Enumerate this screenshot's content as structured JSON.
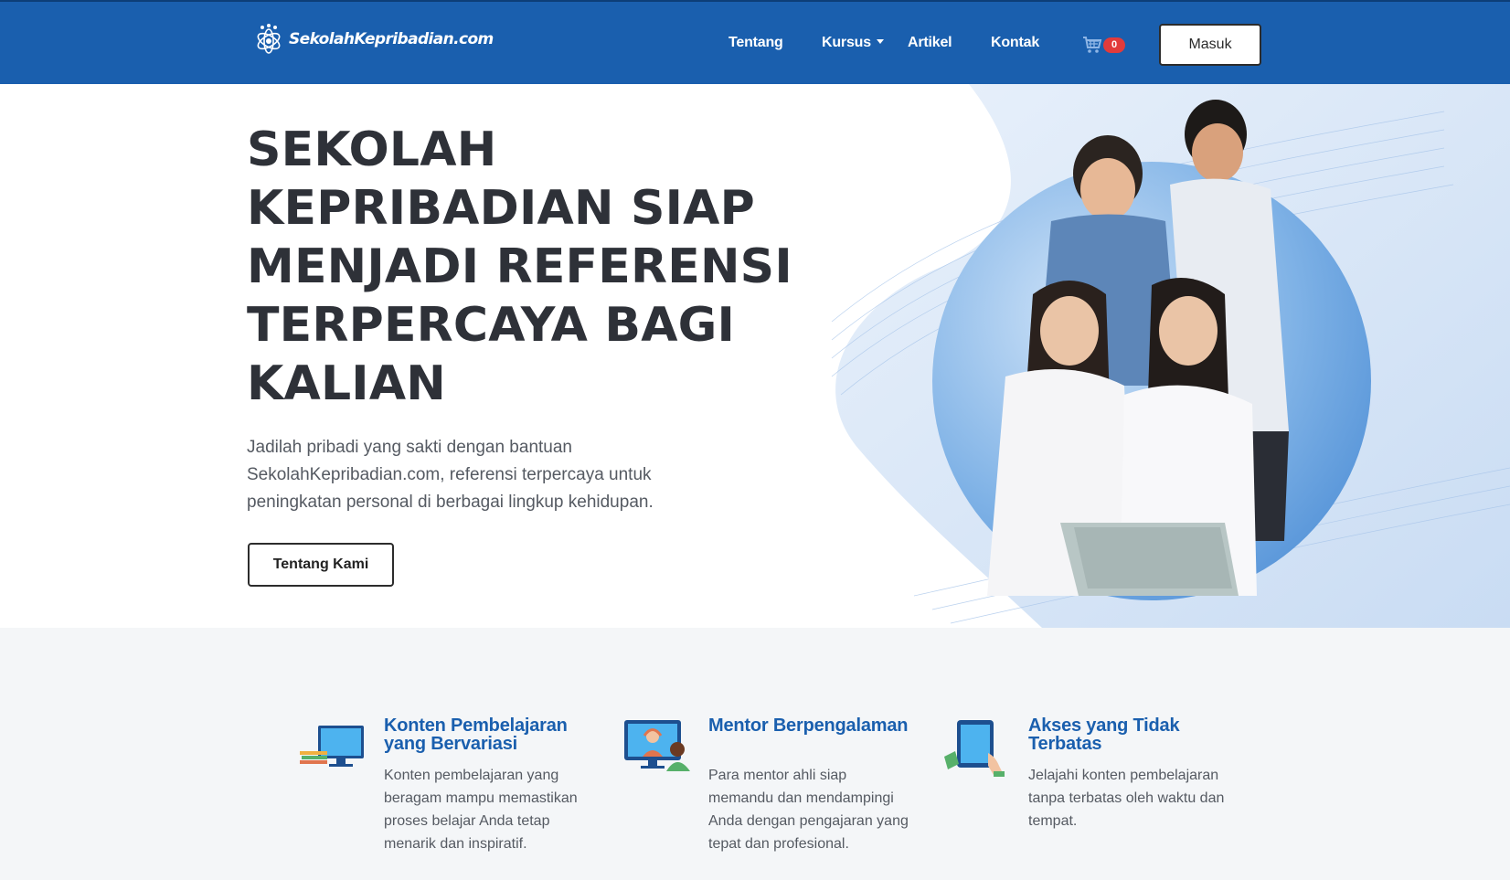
{
  "nav": {
    "logo_text": "SekolahKepribadian.com",
    "items": [
      {
        "label": "Tentang"
      },
      {
        "label": "Kursus"
      },
      {
        "label": "Artikel"
      },
      {
        "label": "Kontak"
      }
    ],
    "cart_count": "0",
    "login_label": "Masuk"
  },
  "hero": {
    "title_lines": [
      "SEKOLAH",
      "KEPRIBADIAN SIAP",
      "MENJADI REFERENSI",
      "TERPERCAYA BAGI",
      "KALIAN"
    ],
    "subtitle": "Jadilah pribadi yang sakti dengan bantuan SekolahKepribadian.com, referensi terpercaya untuk peningkatan personal di berbagai lingkup kehidupan.",
    "cta_label": "Tentang Kami"
  },
  "features": [
    {
      "title": "Konten Pembelajaran yang Bervariasi",
      "description": "Konten pembelajaran yang beragam mampu memastikan proses belajar Anda tetap menarik dan inspiratif."
    },
    {
      "title": "Mentor Berpengalaman",
      "description": "Para mentor ahli siap memandu dan mendampingi Anda dengan pengajaran yang tepat dan profesional."
    },
    {
      "title": "Akses yang Tidak Terbatas",
      "description": "Jelajahi konten pembelajaran tanpa terbatas oleh waktu dan tempat."
    }
  ],
  "colors": {
    "brand_blue": "#1a5fae",
    "heading_dark": "#2e3138",
    "badge_red": "#e23b3b",
    "section_bg": "#f4f6f8"
  },
  "icons": {
    "logo": "atom-logo-icon",
    "cart": "shopping-cart-icon",
    "feature_1": "computer-monitor-books-icon",
    "feature_2": "mentor-video-call-icon",
    "feature_3": "tablet-touch-icon"
  }
}
